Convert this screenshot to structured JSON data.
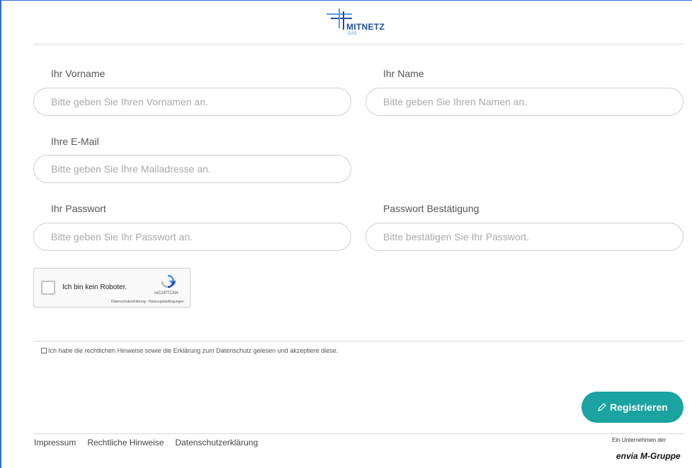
{
  "logo": {
    "name": "MITNETZ",
    "sub": "GAS"
  },
  "form": {
    "first_name_label": "Ihr Vorname",
    "first_name_placeholder": "Bitte geben Sie Ihren Vornamen an.",
    "last_name_label": "Ihr Name",
    "last_name_placeholder": "Bitte geben Sie Ihren Namen an.",
    "email_label": "Ihre E-Mail",
    "email_placeholder": "Bitte geben Sie Ihre Mailadresse an.",
    "password_label": "Ihr Passwort",
    "password_placeholder": "Bitte geben Sie Ihr Passwort an.",
    "password_confirm_label": "Passwort Bestätigung",
    "password_confirm_placeholder": "Bitte bestätigen Sie Ihr Passwort."
  },
  "recaptcha": {
    "label": "Ich bin kein Roboter.",
    "brand": "reCAPTCHA",
    "terms": "Datenschutzerklärung - Nutzungsbedingungen"
  },
  "consent": {
    "text": "Ich habe die rechtlichen Hinweise sowie die Erklärung zum Datenschutz gelesen und akzeptiere diese."
  },
  "actions": {
    "register_label": "Registrieren"
  },
  "footer": {
    "links": [
      "Impressum",
      "Rechtliche Hinweise",
      "Datenschutzerklärung"
    ],
    "group_note": "Ein Unternehmen der",
    "group_logo": "envia M-Gruppe"
  },
  "colors": {
    "accent": "#1aa3a0",
    "brand_blue": "#1f4f9c"
  }
}
